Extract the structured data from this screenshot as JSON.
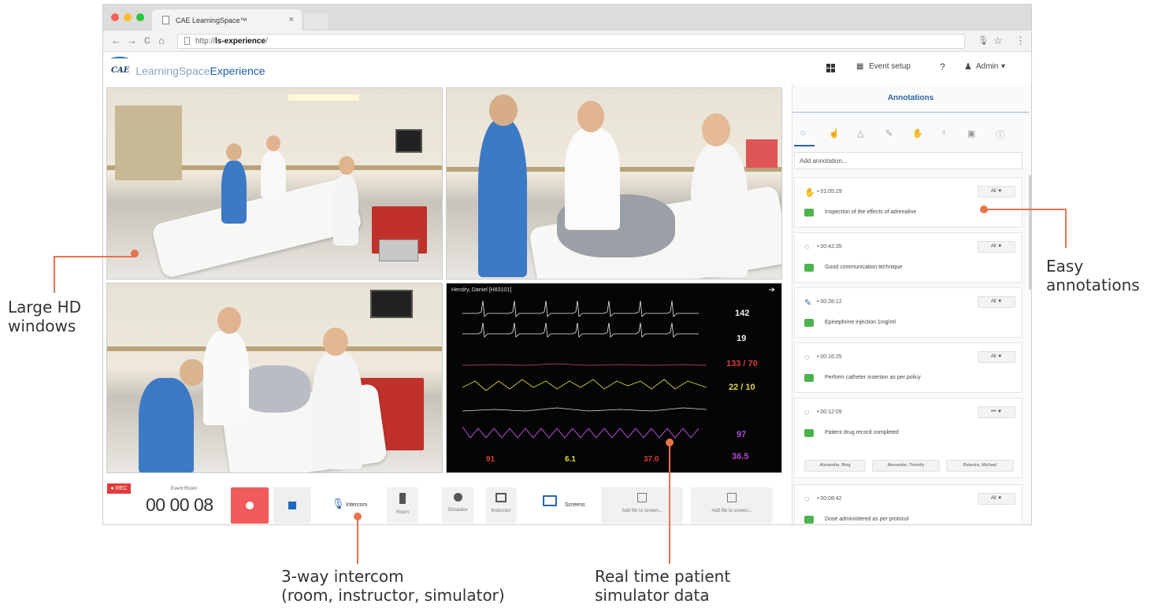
{
  "browser": {
    "tab_title": "CAE LearningSpace™",
    "tab_close": "×",
    "url_protocol": "http://",
    "url_host": "ls-experience",
    "url_path": "/",
    "nav_back": "←",
    "nav_forward": "→",
    "nav_reload": "C",
    "nav_home": "⌂",
    "mic_icon": "🎙",
    "star_icon": "☆",
    "menu_icon": "⋮"
  },
  "header": {
    "logo_cae": "CAE",
    "logo_learningspace": "LearningSpace",
    "logo_experience": "Experience",
    "event_setup": "Event setup",
    "help": "?",
    "admin": "Admin",
    "admin_caret": "▾"
  },
  "vitals": {
    "patient": "Hendry, Daniel [H83101]",
    "values": [
      "142",
      "19",
      "133 / 70",
      "22 / 10",
      "97",
      "36.5"
    ],
    "bottom_values": [
      "91",
      "6.1",
      "37.0"
    ]
  },
  "controls": {
    "rec_label": "● REC",
    "room_label": "Event Room",
    "timer": "00 00 08",
    "intercom": "Intercom",
    "room": "Room",
    "simulator": "Simulator",
    "instructor": "Instructor",
    "screens": "Screens",
    "add_file_1": "Add file to screen...",
    "add_file_2": "Add file to screen..."
  },
  "annotations": {
    "title": "Annotations",
    "add_placeholder": "Add annotation...",
    "items": [
      {
        "icon": "hand-icon",
        "time": "• 01:05:29",
        "filter": "All ▼",
        "text": "Inspection of the effects of adrenaline"
      },
      {
        "icon": "comment-icon",
        "time": "• 00:42:35",
        "filter": "All ▼",
        "text": "Good communication technique"
      },
      {
        "icon": "pencil-icon",
        "time": "• 00:28:12",
        "filter": "All ▼",
        "text": "Epinephrine injection 1mg/ml"
      },
      {
        "icon": "comment-icon",
        "time": "• 00:16:25",
        "filter": "All ▼",
        "text": "Perform catheter insertion as per policy"
      },
      {
        "icon": "comment-icon",
        "time": "• 00:12:09",
        "filter": "••• ▼",
        "text": "Patient drug record completed"
      },
      {
        "icon": "comment-icon",
        "time": "• 00:08:42",
        "filter": "All ▼",
        "text": "Dose administered as per protocol"
      }
    ],
    "chips": [
      "Alexandra, Bing",
      "Alexander, Timothy",
      "Balestra, Michael"
    ]
  },
  "callouts": {
    "large_hd": "Large HD\nwindows",
    "easy_ann": "Easy\nannotations",
    "intercom_line1": "3-way intercom",
    "intercom_line2": "(room, instructor, simulator)",
    "realtime_line1": "Real time patient",
    "realtime_line2": "simulator data"
  },
  "colors": {
    "accent": "#2b65a8",
    "callout": "#e8744c",
    "rec": "#f05a5a"
  }
}
